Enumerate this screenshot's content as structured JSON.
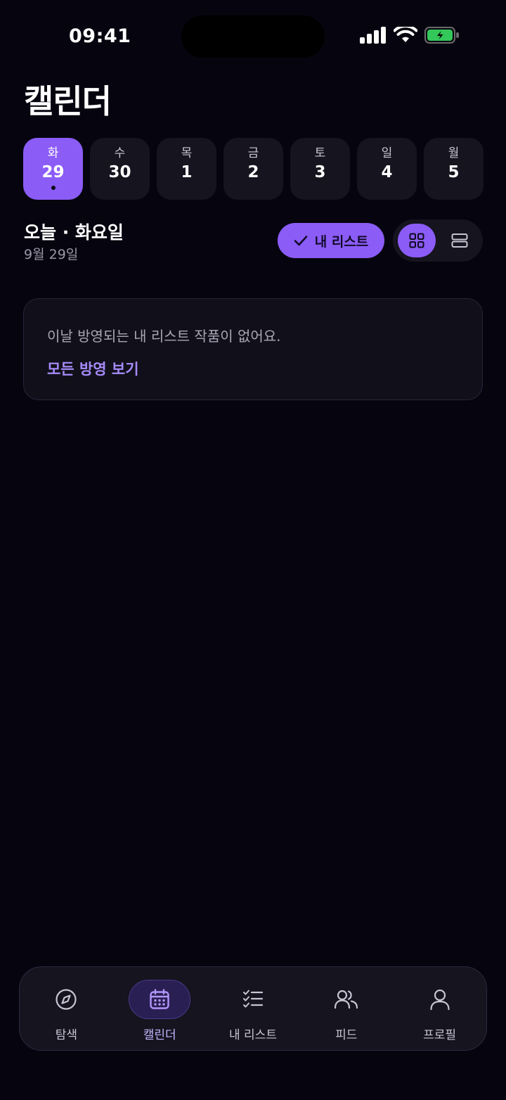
{
  "status_bar": {
    "time": "09:41"
  },
  "header": {
    "title": "캘린더"
  },
  "days": [
    {
      "weekday": "화",
      "date": "29",
      "active": true
    },
    {
      "weekday": "수",
      "date": "30",
      "active": false
    },
    {
      "weekday": "목",
      "date": "1",
      "active": false
    },
    {
      "weekday": "금",
      "date": "2",
      "active": false
    },
    {
      "weekday": "토",
      "date": "3",
      "active": false
    },
    {
      "weekday": "일",
      "date": "4",
      "active": false
    },
    {
      "weekday": "월",
      "date": "5",
      "active": false
    }
  ],
  "today": {
    "title": "오늘 · 화요일",
    "date": "9월 29일"
  },
  "filter": {
    "my_list_label": "내 리스트"
  },
  "empty": {
    "message": "이날 방영되는 내 리스트 작품이 없어요.",
    "link": "모든 방영 보기"
  },
  "tabs": [
    {
      "label": "탐색",
      "icon": "compass-icon",
      "active": false
    },
    {
      "label": "캘린더",
      "icon": "calendar-icon",
      "active": true
    },
    {
      "label": "내 리스트",
      "icon": "checklist-icon",
      "active": false
    },
    {
      "label": "피드",
      "icon": "users-icon",
      "active": false
    },
    {
      "label": "프로필",
      "icon": "user-icon",
      "active": false
    }
  ],
  "colors": {
    "background": "#06050f",
    "accent": "#8b5cf6",
    "accent_light": "#a78bfa",
    "surface": "#15141f",
    "battery": "#34c759"
  }
}
